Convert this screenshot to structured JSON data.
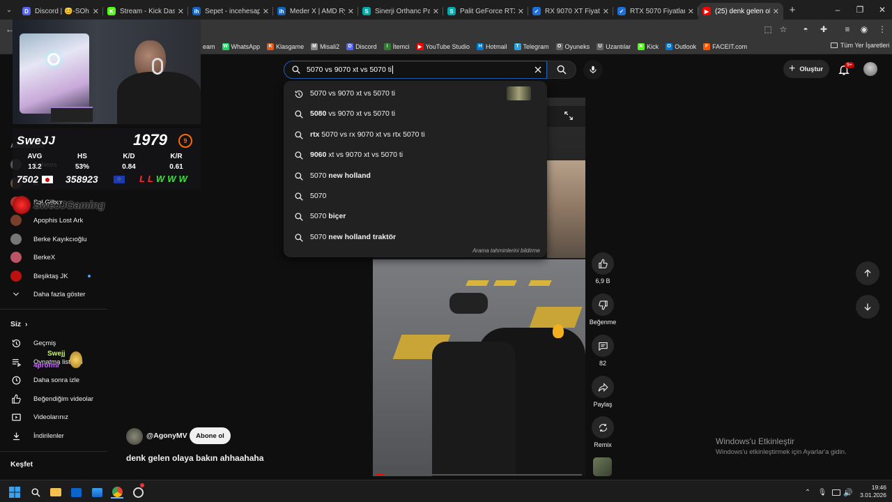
{
  "browser": {
    "tabs": [
      {
        "label": "Discord | 😊-SOh",
        "fav_color": "#5865f2",
        "fav_glyph": "D"
      },
      {
        "label": "Stream - Kick Dashbo",
        "fav_color": "#53fc18",
        "fav_glyph": "K"
      },
      {
        "label": "Sepet - incehesap.com",
        "fav_color": "#1565c0",
        "fav_glyph": "ih"
      },
      {
        "label": "Meder X | AMD Ryzen",
        "fav_color": "#1565c0",
        "fav_glyph": "ih"
      },
      {
        "label": "Sinerji Orthanc Palit G",
        "fav_color": "#0aa",
        "fav_glyph": "S"
      },
      {
        "label": "Palit GeForce RTX 50",
        "fav_color": "#0aa",
        "fav_glyph": "S"
      },
      {
        "label": "RX 9070 XT Fiyatları",
        "fav_color": "#1e6fd9",
        "fav_glyph": "✓"
      },
      {
        "label": "RTX 5070 Fiyatları | E",
        "fav_color": "#1e6fd9",
        "fav_glyph": "✓"
      },
      {
        "label": "(25) denk gelen olaya",
        "fav_color": "#ff0000",
        "fav_glyph": "▶"
      }
    ],
    "window_controls": [
      "minimize",
      "maximize",
      "close"
    ],
    "bookmarks": [
      {
        "label": "eam",
        "color": "#1b2838",
        "glyph": ""
      },
      {
        "label": "WhatsApp",
        "color": "#25d366",
        "glyph": "W"
      },
      {
        "label": "Klasgame",
        "color": "#e05a1c",
        "glyph": "K"
      },
      {
        "label": "Misali2",
        "color": "#888",
        "glyph": "M"
      },
      {
        "label": "Discord",
        "color": "#5865f2",
        "glyph": "D"
      },
      {
        "label": "İtemci",
        "color": "#2e7d32",
        "glyph": "i"
      },
      {
        "label": "YouTube Studio",
        "color": "#ff0000",
        "glyph": "▶"
      },
      {
        "label": "Hotmail",
        "color": "#0078d4",
        "glyph": "H"
      },
      {
        "label": "Telegram",
        "color": "#2aa1da",
        "glyph": "T"
      },
      {
        "label": "Oyuneks",
        "color": "#666",
        "glyph": "O"
      },
      {
        "label": "Uzantılar",
        "color": "#666",
        "glyph": "U"
      },
      {
        "label": "Kick",
        "color": "#53fc18",
        "glyph": "K"
      },
      {
        "label": "Outlook",
        "color": "#0078d4",
        "glyph": "O"
      },
      {
        "label": "FACEIT.com",
        "color": "#ff5500",
        "glyph": "F"
      }
    ],
    "all_bookmarks_label": "Tüm Yer İşaretleri"
  },
  "youtube": {
    "search": {
      "query": "5070 vs 9070 xt vs 5070 ti",
      "suggestions": [
        {
          "prefix": "",
          "bold": "",
          "text": "5070 vs 9070 xt vs 5070 ti",
          "icon": "history-icon",
          "has_thumb": true
        },
        {
          "prefix": "",
          "bold": "5080",
          "text": " vs 9070 xt vs 5070 ti",
          "icon": "search-icon",
          "has_thumb": false
        },
        {
          "prefix": "",
          "bold": "rtx",
          "text": " 5070 vs rx 9070 xt vs rtx 5070 ti",
          "icon": "search-icon",
          "has_thumb": false
        },
        {
          "prefix": "",
          "bold": "9060",
          "text": " xt vs 9070 xt vs 5070 ti",
          "icon": "search-icon",
          "has_thumb": false
        },
        {
          "prefix": "5070 ",
          "bold": "new holland",
          "text": "",
          "icon": "search-icon",
          "has_thumb": false
        },
        {
          "prefix": "5070",
          "bold": "",
          "text": "",
          "icon": "search-icon",
          "has_thumb": false
        },
        {
          "prefix": "5070 ",
          "bold": "biçer",
          "text": "",
          "icon": "search-icon",
          "has_thumb": false
        },
        {
          "prefix": "5070 ",
          "bold": "new holland traktör",
          "text": "",
          "icon": "search-icon",
          "has_thumb": false
        }
      ],
      "footer": "Arama tahminlerini bildirme"
    },
    "create_label": "Oluştur",
    "notification_count": "9+",
    "sidebar": {
      "subs_header": "Abonelikler",
      "subscriptions": [
        {
          "label": "AcNees"
        },
        {
          "label": "A"
        },
        {
          "label": "Sol Gilbur"
        },
        {
          "label": "Apophis Lost Ark"
        },
        {
          "label": "Berke Kayıkcıoğlu"
        },
        {
          "label": "BerkeX"
        },
        {
          "label": "Beşiktaş JK"
        }
      ],
      "show_more": "Daha fazla göster",
      "you_header": "Siz",
      "you_items": [
        {
          "label": "Geçmiş",
          "icon": "history-icon"
        },
        {
          "label": "Oynatma listeleri",
          "icon": "playlist-icon"
        },
        {
          "label": "Daha sonra izle",
          "icon": "clock-icon"
        },
        {
          "label": "Beğendiğim videolar",
          "icon": "like-icon"
        },
        {
          "label": "Videolarınız",
          "icon": "video-icon"
        },
        {
          "label": "İndirilenler",
          "icon": "download-icon"
        }
      ],
      "explore_header": "Keşfet"
    },
    "short": {
      "channel": "@AgonyMV",
      "subscribe": "Abone ol",
      "title": "denk gelen olaya bakın ahhaahaha",
      "likes": "6,9 B",
      "dislike_label": "Beğenme",
      "comments": "82",
      "share_label": "Paylaş",
      "remix_label": "Remix"
    }
  },
  "overlay": {
    "player": "SweJJ",
    "elo": "1979",
    "level": "9",
    "stats_headers": [
      "AVG",
      "HS",
      "K/D",
      "K/R"
    ],
    "stats_values": [
      "13.2",
      "53%",
      "0.84",
      "0.61"
    ],
    "rank": "7502",
    "region_rank": "358923",
    "recent": [
      "L",
      "L",
      "W",
      "W",
      "W"
    ],
    "brand": "SweJJGaming",
    "chat_name": "Swejj",
    "chat_name2": "4profmr"
  },
  "windows": {
    "activate_title": "Windows'u Etkinleştir",
    "activate_sub": "Windows'u etkinleştirmek için Ayarlar'a gidin.",
    "time": "19:46",
    "date": "3.01.2026"
  }
}
